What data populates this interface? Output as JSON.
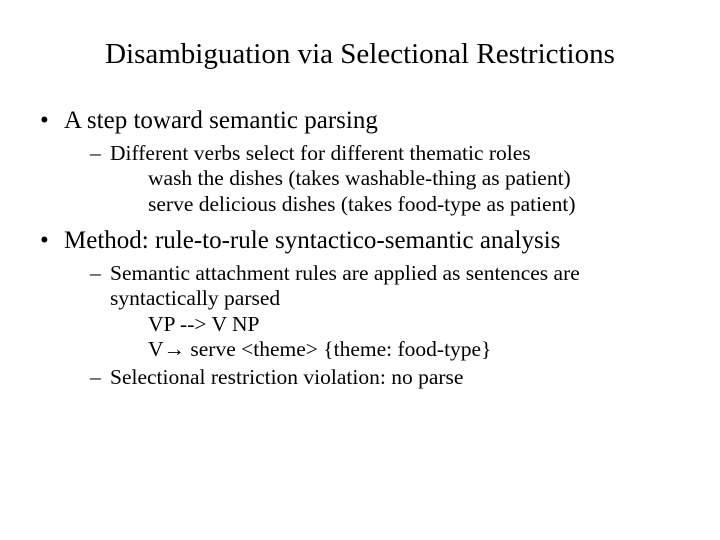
{
  "title": "Disambiguation via Selectional Restrictions",
  "bullets": {
    "b1": "A step toward semantic parsing",
    "b1s1": "Different verbs select for different thematic roles",
    "b1s1a": "wash the dishes (takes washable-thing as patient)",
    "b1s1b": "serve delicious dishes (takes food-type as patient)",
    "b2": "Method: rule-to-rule syntactico-semantic analysis",
    "b2s1": "Semantic attachment rules are applied as sentences are syntactically parsed",
    "b2s1a": "VP --> V NP",
    "b2s1b": "V→ serve <theme> {theme: food-type}",
    "b2s2": "Selectional restriction violation: no parse"
  }
}
